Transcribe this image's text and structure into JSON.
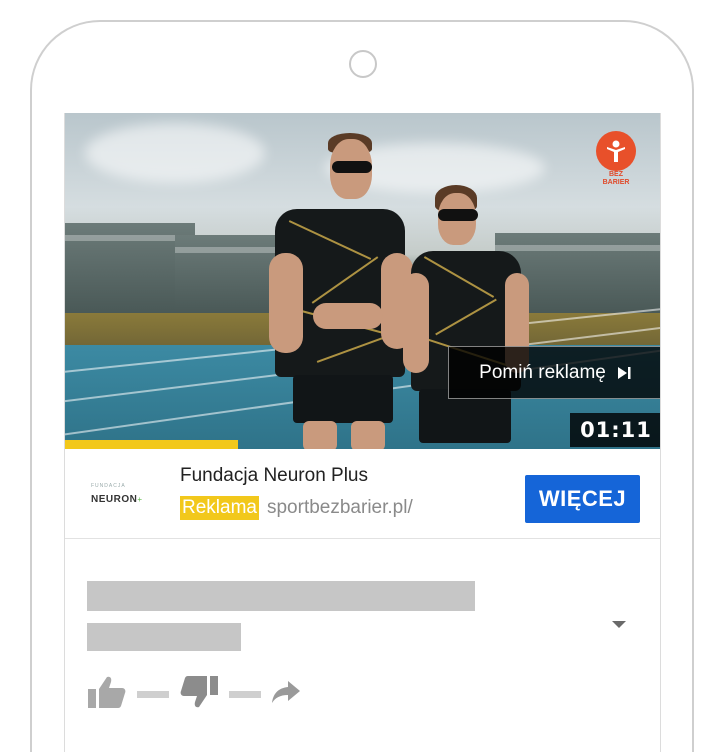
{
  "video": {
    "skip_label": "Pomiń reklamę",
    "timer": "01:11",
    "progress_fraction": 0.29,
    "channel_logo_text": [
      "BEZ",
      "BARIER"
    ]
  },
  "ad": {
    "brand_logo_small": "FUNDACJA",
    "brand_logo_big": "NEURON",
    "brand_logo_plus": "+",
    "advertiser": "Fundacja Neuron Plus",
    "badge": "Reklama",
    "url": "sportbezbarier.pl/",
    "cta": "WIĘCEJ"
  },
  "colors": {
    "accent_yellow": "#f2c81b",
    "cta_blue": "#1565d8",
    "placeholder_gray": "#c6c6c6"
  },
  "icons": [
    "camera-icon",
    "skip-icon",
    "thumbs-up-icon",
    "thumbs-down-icon",
    "share-icon",
    "chevron-down-icon"
  ]
}
